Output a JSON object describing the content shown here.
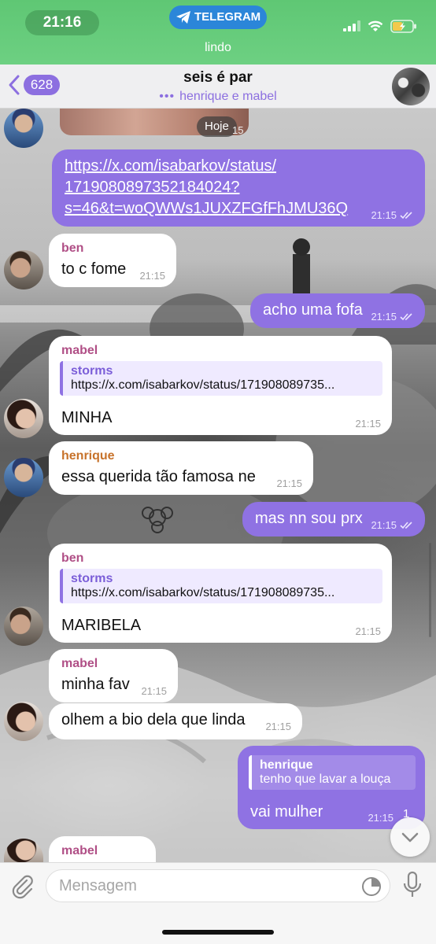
{
  "status_bar": {
    "time": "21:16",
    "app_pill": "TELEGRAM",
    "subtitle": "lindo",
    "colors": {
      "bar": "#5fc774",
      "pill": "#2b86d9"
    }
  },
  "header": {
    "back_count": "628",
    "title": "seis é par",
    "typing_text": "henrique e mabel"
  },
  "top_photo": {
    "date_label": "Hoje",
    "time": "15"
  },
  "messages": [
    {
      "id": "m1",
      "direction": "out",
      "link_lines": [
        "https://x.com/isabarkov/status/",
        "1719080897352184024?",
        "s=46&t=woQWWs1JUXZFGfFhJMU36Q"
      ],
      "time": "21:15",
      "read": true
    },
    {
      "id": "m2",
      "direction": "in",
      "sender": "ben",
      "text": "to c fome",
      "time": "21:15"
    },
    {
      "id": "m3",
      "direction": "out",
      "text": "acho uma fofa",
      "time": "21:15",
      "read": true
    },
    {
      "id": "m4",
      "direction": "in",
      "sender": "mabel",
      "quote_name": "storms",
      "quote_text": "https://x.com/isabarkov/status/171908089735...",
      "text": "MINHA",
      "time": "21:15"
    },
    {
      "id": "m5",
      "direction": "in",
      "sender": "henrique",
      "text": "essa querida tão famosa ne",
      "time": "21:15"
    },
    {
      "id": "m6",
      "direction": "out",
      "text": "mas nn sou prx",
      "time": "21:15",
      "read": true
    },
    {
      "id": "m7",
      "direction": "in",
      "sender": "ben",
      "quote_name": "storms",
      "quote_text": "https://x.com/isabarkov/status/171908089735...",
      "text": "MARIBELA",
      "time": "21:15"
    },
    {
      "id": "m8",
      "direction": "in",
      "sender": "mabel",
      "text": "minha fav",
      "time": "21:15"
    },
    {
      "id": "m9",
      "direction": "in",
      "text": "olhem a bio dela que linda",
      "time": "21:15"
    },
    {
      "id": "m10",
      "direction": "out",
      "quote_name": "henrique",
      "quote_text": "tenho que lavar a louça",
      "text": "vai mulher",
      "time": "21:15"
    },
    {
      "id": "m11",
      "direction": "in",
      "sender": "mabel"
    }
  ],
  "scroll_button": {
    "unread": "1"
  },
  "composer": {
    "placeholder": "Mensagem"
  },
  "icons": [
    "telegram-plane-icon",
    "signal-icon",
    "wifi-icon",
    "battery-icon",
    "chevron-left-icon",
    "double-check-icon",
    "chevron-down-icon",
    "paperclip-icon",
    "sticker-icon",
    "microphone-icon"
  ],
  "colors": {
    "outgoing_bubble": "#8f72e3",
    "incoming_bubble": "#ffffff",
    "accent": "#8c6fe0",
    "sender_ben_mabel": "#b04f86",
    "sender_henrique": "#c7722a"
  }
}
